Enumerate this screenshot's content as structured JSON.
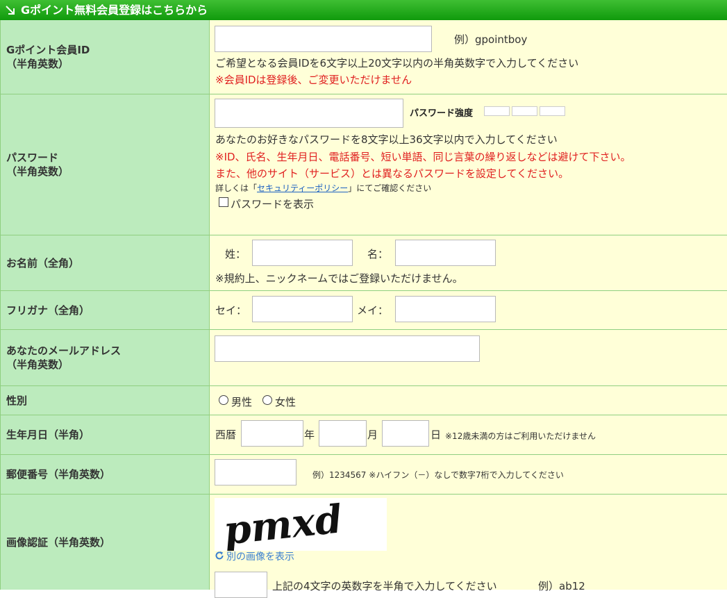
{
  "header": {
    "title": "Gポイント無料会員登録はこちらから"
  },
  "member_id": {
    "label": "Gポイント会員ID",
    "label_sub": "（半角英数）",
    "example": "例）gpointboy",
    "help": "ご希望となる会員IDを6文字以上20文字以内の半角英数字で入力してください",
    "warning": "※会員IDは登録後、ご変更いただけません"
  },
  "password": {
    "label": "パスワード",
    "label_sub": "（半角英数）",
    "strength_label": "パスワード強度",
    "help": "あなたのお好きなパスワードを8文字以上36文字以内で入力してください",
    "warning1": "※ID、氏名、生年月日、電話番号、短い単語、同じ言葉の繰り返しなどは避けて下さい。",
    "warning2": "また、他のサイト（サービス）とは異なるパスワードを設定してください。",
    "policy_prefix": "詳しくは「",
    "policy_link": "セキュリティーポリシー",
    "policy_suffix": "」にてご確認ください",
    "show_label": "パスワードを表示"
  },
  "name": {
    "label": "お名前（全角）",
    "sei_label": "姓：",
    "mei_label": "名：",
    "note": "※規約上、ニックネームではご登録いただけません。"
  },
  "furigana": {
    "label": "フリガナ（全角）",
    "sei_label": "セイ：",
    "mei_label": "メイ："
  },
  "email": {
    "label": "あなたのメールアドレス",
    "label_sub": "（半角英数）"
  },
  "gender": {
    "label": "性別",
    "male": "男性",
    "female": "女性"
  },
  "birthday": {
    "label": "生年月日（半角）",
    "era": "西暦",
    "year": "年",
    "month": "月",
    "day": "日",
    "note": "※12歳未満の方はご利用いただけません"
  },
  "postal": {
    "label": "郵便番号（半角英数）",
    "note": "例）1234567 ※ハイフン（－）なしで数字7桁で入力してください"
  },
  "captcha": {
    "label": "画像認証（半角英数）",
    "image_text": "pmxd",
    "refresh_label": "別の画像を表示",
    "help": "上記の4文字の英数字を半角で入力してください",
    "example": "例）ab12"
  }
}
